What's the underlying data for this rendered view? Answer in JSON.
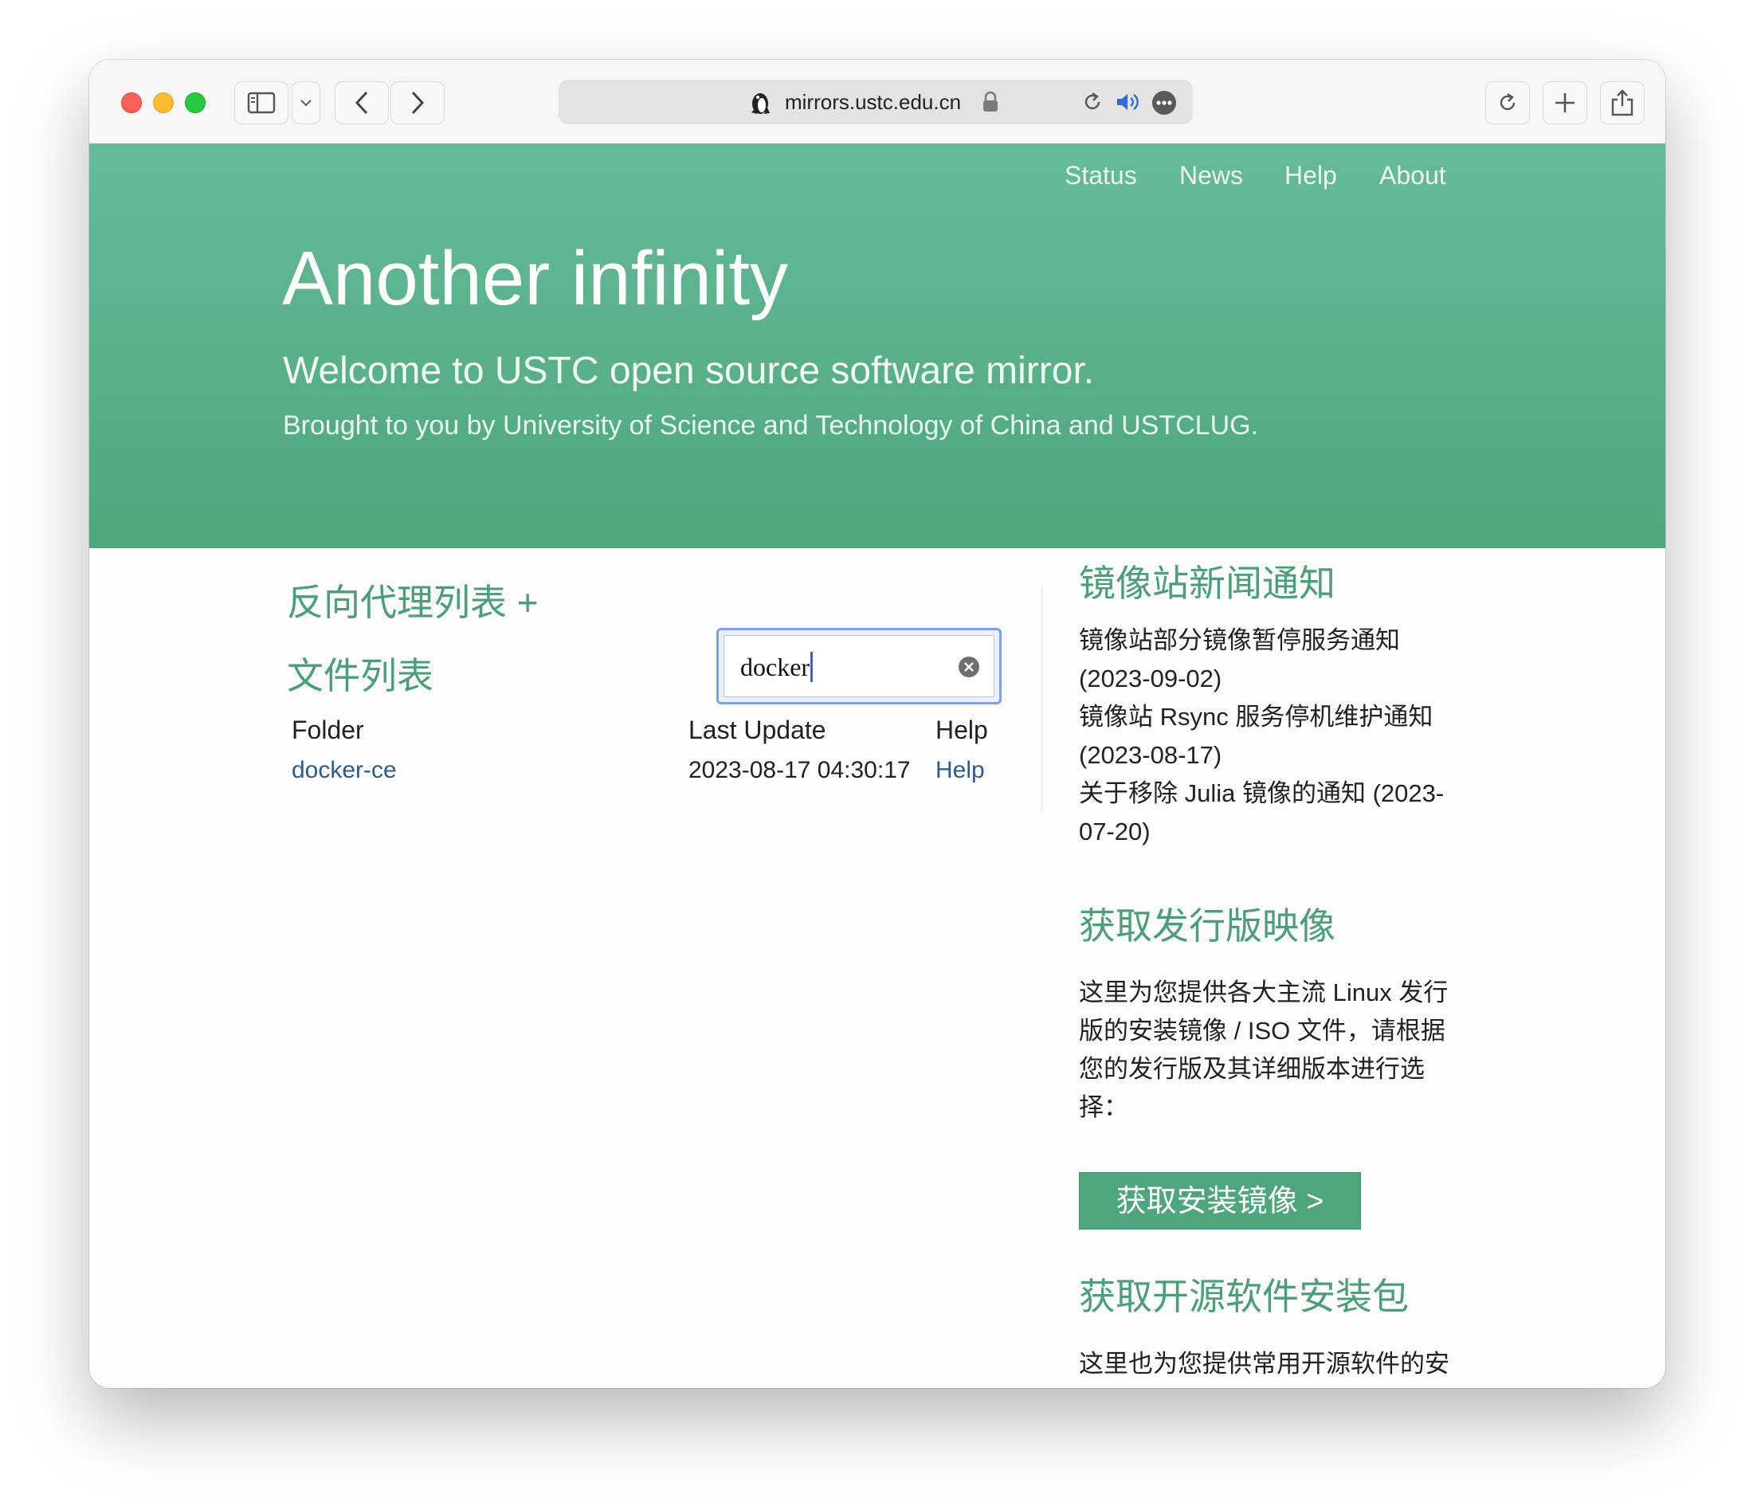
{
  "browser": {
    "url": "mirrors.ustc.edu.cn"
  },
  "nav": {
    "status": "Status",
    "news": "News",
    "help": "Help",
    "about": "About"
  },
  "hero": {
    "title": "Another infinity",
    "subtitle": "Welcome to USTC open source software mirror.",
    "byline": "Brought to you by University of Science and Technology of China and USTCLUG."
  },
  "left": {
    "proxy_title": "反向代理列表 +",
    "files_title": "文件列表",
    "search_value": "docker",
    "table": {
      "headers": [
        "Folder",
        "Last Update",
        "Help"
      ],
      "rows": [
        {
          "folder": "docker-ce",
          "last_update": "2023-08-17 04:30:17",
          "help": "Help"
        }
      ]
    }
  },
  "right": {
    "news_title": "镜像站新闻通知",
    "news": [
      "镜像站部分镜像暂停服务通知 (2023-09-02)",
      "镜像站 Rsync 服务停机维护通知 (2023-08-17)",
      "关于移除 Julia 镜像的通知 (2023-07-20)"
    ],
    "distro_title": "获取发行版映像",
    "distro_text": "这里为您提供各大主流 Linux 发行版的安装镜像 / ISO 文件，请根据您的发行版及其详细版本进行选择：",
    "distro_button": "获取安装镜像 >",
    "software_title": "获取开源软件安装包",
    "software_text": "这里也为您提供常用开源软件的安"
  },
  "colors": {
    "accent": "#4ea67d",
    "link": "#2f5c8a"
  }
}
